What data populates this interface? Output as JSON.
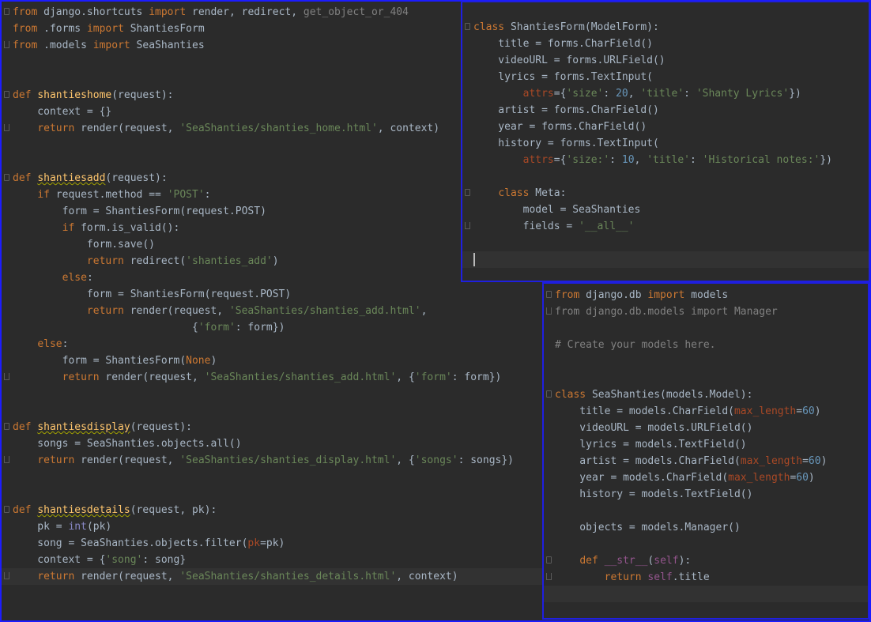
{
  "views_file": {
    "lines": [
      [
        [
          "k",
          "from"
        ],
        [
          "t",
          " django.shortcuts "
        ],
        [
          "k",
          "import"
        ],
        [
          "t",
          " render, redirect, "
        ],
        [
          "d",
          "get_object_or_404"
        ]
      ],
      [
        [
          "k",
          "from"
        ],
        [
          "t",
          " .forms "
        ],
        [
          "k",
          "import"
        ],
        [
          "t",
          " ShantiesForm"
        ]
      ],
      [
        [
          "k",
          "from"
        ],
        [
          "t",
          " .models "
        ],
        [
          "k",
          "import"
        ],
        [
          "t",
          " SeaShanties"
        ]
      ],
      [],
      [],
      [
        [
          "k",
          "def"
        ],
        [
          "t",
          " "
        ],
        [
          "f",
          "shantieshome"
        ],
        [
          "t",
          "(request):"
        ]
      ],
      [
        [
          "t",
          "    context = {}"
        ]
      ],
      [
        [
          "t",
          "    "
        ],
        [
          "k",
          "return"
        ],
        [
          "t",
          " render(request, "
        ],
        [
          "s",
          "'SeaShanties/shanties_home.html'"
        ],
        [
          "t",
          ", context)"
        ]
      ],
      [],
      [],
      [
        [
          "k",
          "def"
        ],
        [
          "t",
          " "
        ],
        [
          "fu",
          "shantiesadd"
        ],
        [
          "t",
          "(request):"
        ]
      ],
      [
        [
          "t",
          "    "
        ],
        [
          "k",
          "if"
        ],
        [
          "t",
          " request.method == "
        ],
        [
          "s",
          "'POST'"
        ],
        [
          "t",
          ":"
        ]
      ],
      [
        [
          "t",
          "        form = ShantiesForm(request.POST)"
        ]
      ],
      [
        [
          "t",
          "        "
        ],
        [
          "k",
          "if"
        ],
        [
          "t",
          " form.is_valid():"
        ]
      ],
      [
        [
          "t",
          "            form.save()"
        ]
      ],
      [
        [
          "t",
          "            "
        ],
        [
          "k",
          "return"
        ],
        [
          "t",
          " redirect("
        ],
        [
          "s",
          "'shanties_add'"
        ],
        [
          "t",
          ")"
        ]
      ],
      [
        [
          "t",
          "        "
        ],
        [
          "k",
          "else"
        ],
        [
          "t",
          ":"
        ]
      ],
      [
        [
          "t",
          "            form = ShantiesForm(request.POST)"
        ]
      ],
      [
        [
          "t",
          "            "
        ],
        [
          "k",
          "return"
        ],
        [
          "t",
          " render(request, "
        ],
        [
          "s",
          "'SeaShanties/shanties_add.html'"
        ],
        [
          "t",
          ","
        ]
      ],
      [
        [
          "t",
          "                             {"
        ],
        [
          "s",
          "'form'"
        ],
        [
          "t",
          ": form})"
        ]
      ],
      [
        [
          "t",
          "    "
        ],
        [
          "k",
          "else"
        ],
        [
          "t",
          ":"
        ]
      ],
      [
        [
          "t",
          "        form = ShantiesForm("
        ],
        [
          "k",
          "None"
        ],
        [
          "t",
          ")"
        ]
      ],
      [
        [
          "t",
          "        "
        ],
        [
          "k",
          "return"
        ],
        [
          "t",
          " render(request, "
        ],
        [
          "s",
          "'SeaShanties/shanties_add.html'"
        ],
        [
          "t",
          ", {"
        ],
        [
          "s",
          "'form'"
        ],
        [
          "t",
          ": form})"
        ]
      ],
      [],
      [],
      [
        [
          "k",
          "def"
        ],
        [
          "t",
          " "
        ],
        [
          "fu",
          "shantiesdisplay"
        ],
        [
          "t",
          "(request):"
        ]
      ],
      [
        [
          "t",
          "    songs = SeaShanties.objects.all()"
        ]
      ],
      [
        [
          "t",
          "    "
        ],
        [
          "k",
          "return"
        ],
        [
          "t",
          " render(request, "
        ],
        [
          "s",
          "'SeaShanties/shanties_display.html'"
        ],
        [
          "t",
          ", {"
        ],
        [
          "s",
          "'songs'"
        ],
        [
          "t",
          ": songs})"
        ]
      ],
      [],
      [],
      [
        [
          "k",
          "def"
        ],
        [
          "t",
          " "
        ],
        [
          "fu",
          "shantiesdetails"
        ],
        [
          "t",
          "(request, pk):"
        ]
      ],
      [
        [
          "t",
          "    pk = "
        ],
        [
          "b",
          "int"
        ],
        [
          "t",
          "(pk)"
        ]
      ],
      [
        [
          "t",
          "    song = SeaShanties.objects.filter("
        ],
        [
          "a",
          "pk"
        ],
        [
          "t",
          "=pk)"
        ]
      ],
      [
        [
          "t",
          "    context = {"
        ],
        [
          "s",
          "'song'"
        ],
        [
          "t",
          ": song}"
        ]
      ],
      [
        [
          "t",
          "    "
        ],
        [
          "k",
          "return"
        ],
        [
          "t",
          " render(request, "
        ],
        [
          "s",
          "'SeaShanties/shanties_details.html'"
        ],
        [
          "t",
          ", context)"
        ]
      ]
    ]
  },
  "forms_file": {
    "lines": [
      [
        [
          "k",
          "class"
        ],
        [
          "t",
          " ShantiesForm(ModelForm):"
        ]
      ],
      [
        [
          "t",
          "    title = forms.CharField()"
        ]
      ],
      [
        [
          "t",
          "    videoURL = forms.URLField()"
        ]
      ],
      [
        [
          "t",
          "    lyrics = forms.TextInput("
        ]
      ],
      [
        [
          "t",
          "        "
        ],
        [
          "a",
          "attrs"
        ],
        [
          "t",
          "={"
        ],
        [
          "s",
          "'size'"
        ],
        [
          "t",
          ": "
        ],
        [
          "n",
          "20"
        ],
        [
          "t",
          ", "
        ],
        [
          "s",
          "'title'"
        ],
        [
          "t",
          ": "
        ],
        [
          "s",
          "'Shanty Lyrics'"
        ],
        [
          "t",
          "})"
        ]
      ],
      [
        [
          "t",
          "    artist = forms.CharField()"
        ]
      ],
      [
        [
          "t",
          "    year = forms.CharField()"
        ]
      ],
      [
        [
          "t",
          "    history = forms.TextInput("
        ]
      ],
      [
        [
          "t",
          "        "
        ],
        [
          "a",
          "attrs"
        ],
        [
          "t",
          "={"
        ],
        [
          "s",
          "'size:'"
        ],
        [
          "t",
          ": "
        ],
        [
          "n",
          "10"
        ],
        [
          "t",
          ", "
        ],
        [
          "s",
          "'title'"
        ],
        [
          "t",
          ": "
        ],
        [
          "s",
          "'Historical notes:'"
        ],
        [
          "t",
          "})"
        ]
      ],
      [],
      [
        [
          "t",
          "    "
        ],
        [
          "k",
          "class"
        ],
        [
          "t",
          " Meta:"
        ]
      ],
      [
        [
          "t",
          "        model = SeaShanties"
        ]
      ],
      [
        [
          "t",
          "        fields = "
        ],
        [
          "s",
          "'__all__'"
        ]
      ],
      [],
      []
    ]
  },
  "models_file": {
    "lines": [
      [
        [
          "k",
          "from"
        ],
        [
          "t",
          " django.db "
        ],
        [
          "k",
          "import"
        ],
        [
          "t",
          " models"
        ]
      ],
      [
        [
          "d",
          "from django.db.models import Manager"
        ]
      ],
      [],
      [
        [
          "c",
          "# Create your models here."
        ]
      ],
      [],
      [],
      [
        [
          "k",
          "class"
        ],
        [
          "t",
          " SeaShanties(models.Model):"
        ]
      ],
      [
        [
          "t",
          "    title = models.CharField("
        ],
        [
          "a",
          "max_length"
        ],
        [
          "t",
          "="
        ],
        [
          "n",
          "60"
        ],
        [
          "t",
          ")"
        ]
      ],
      [
        [
          "t",
          "    videoURL = models.URLField()"
        ]
      ],
      [
        [
          "t",
          "    lyrics = models.TextField()"
        ]
      ],
      [
        [
          "t",
          "    artist = models.CharField("
        ],
        [
          "a",
          "max_length"
        ],
        [
          "t",
          "="
        ],
        [
          "n",
          "60"
        ],
        [
          "t",
          ")"
        ]
      ],
      [
        [
          "t",
          "    year = models.CharField("
        ],
        [
          "a",
          "max_length"
        ],
        [
          "t",
          "="
        ],
        [
          "n",
          "60"
        ],
        [
          "t",
          ")"
        ]
      ],
      [
        [
          "t",
          "    history = models.TextField()"
        ]
      ],
      [],
      [
        [
          "t",
          "    objects = models.Manager()"
        ]
      ],
      [],
      [
        [
          "t",
          "    "
        ],
        [
          "k",
          "def"
        ],
        [
          "t",
          " "
        ],
        [
          "p",
          "__str__"
        ],
        [
          "t",
          "("
        ],
        [
          "p",
          "self"
        ],
        [
          "t",
          "):"
        ]
      ],
      [
        [
          "t",
          "        "
        ],
        [
          "k",
          "return"
        ],
        [
          "t",
          " "
        ],
        [
          "p",
          "self"
        ],
        [
          "t",
          ".title"
        ]
      ],
      []
    ]
  }
}
